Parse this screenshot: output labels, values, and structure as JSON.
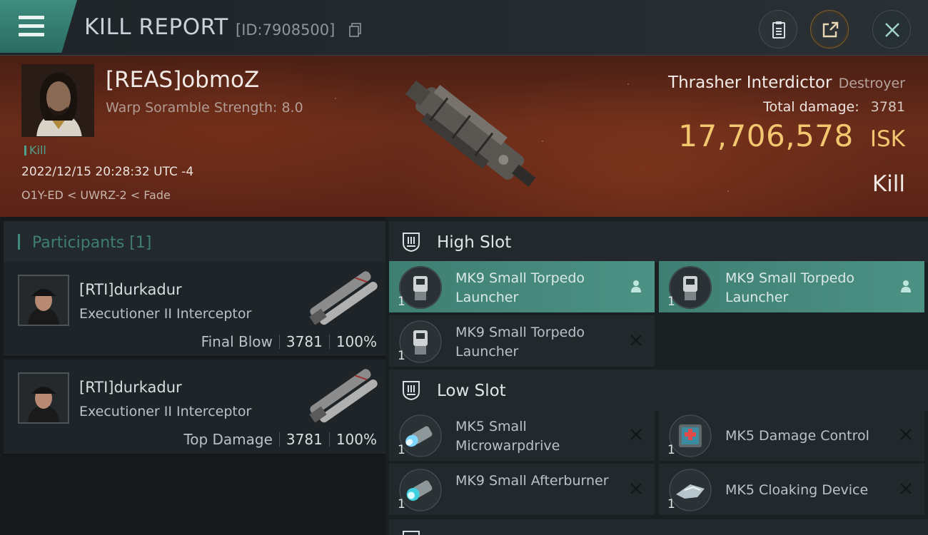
{
  "header": {
    "title": "KILL REPORT",
    "report_id": "[ID:7908500]"
  },
  "victim": {
    "name": "[REAS]obmoZ",
    "subtitle": "Warp Soramble Strength: 8.0",
    "tag": "Kill",
    "datetime": "2022/12/15 20:28:32 UTC -4",
    "location": "O1Y-ED < UWRZ-2 < Fade",
    "ship_name": "Thrasher Interdictor",
    "ship_class": "Destroyer",
    "total_damage_label": "Total damage:",
    "total_damage": "3781",
    "isk_value": "17,706,578",
    "isk_unit": "ISK",
    "result": "Kill"
  },
  "participants": {
    "title": "Participants [1]",
    "rows": [
      {
        "name": "[RTI]durkadur",
        "ship": "Executioner II Interceptor",
        "role": "Final Blow",
        "damage": "3781",
        "percent": "100%"
      },
      {
        "name": "[RTI]durkadur",
        "ship": "Executioner II Interceptor",
        "role": "Top Damage",
        "damage": "3781",
        "percent": "100%"
      }
    ]
  },
  "fitting": {
    "high_slot": {
      "title": "High Slot",
      "modules": [
        {
          "qty": "1",
          "name": "MK9 Small Torpedo Launcher",
          "status": "person-icon",
          "active": true
        },
        {
          "qty": "1",
          "name": "MK9 Small Torpedo Launcher",
          "status": "person-icon",
          "active": true
        },
        {
          "qty": "1",
          "name": "MK9 Small Torpedo Launcher",
          "status": "close-icon",
          "active": false
        }
      ]
    },
    "low_slot": {
      "title": "Low Slot",
      "modules": [
        {
          "qty": "1",
          "name": "MK5 Small Microwarpdrive",
          "status": "close-icon",
          "active": false
        },
        {
          "qty": "1",
          "name": "MK5 Damage Control",
          "status": "close-icon",
          "active": false
        },
        {
          "qty": "1",
          "name": "MK9 Small Afterburner",
          "status": "close-icon",
          "active": false
        },
        {
          "qty": "1",
          "name": "MK5 Cloaking Device",
          "status": "close-icon",
          "active": false
        }
      ]
    }
  },
  "icons": {
    "menu": "hamburger-menu-icon",
    "copy": "copy-icon",
    "clipboard": "clipboard-icon",
    "share": "share-icon",
    "close": "close-icon",
    "slot": "slot-shield-icon"
  },
  "colors": {
    "accent": "#3f8c80",
    "isk": "#f2c770",
    "hero": "#5b2417"
  }
}
